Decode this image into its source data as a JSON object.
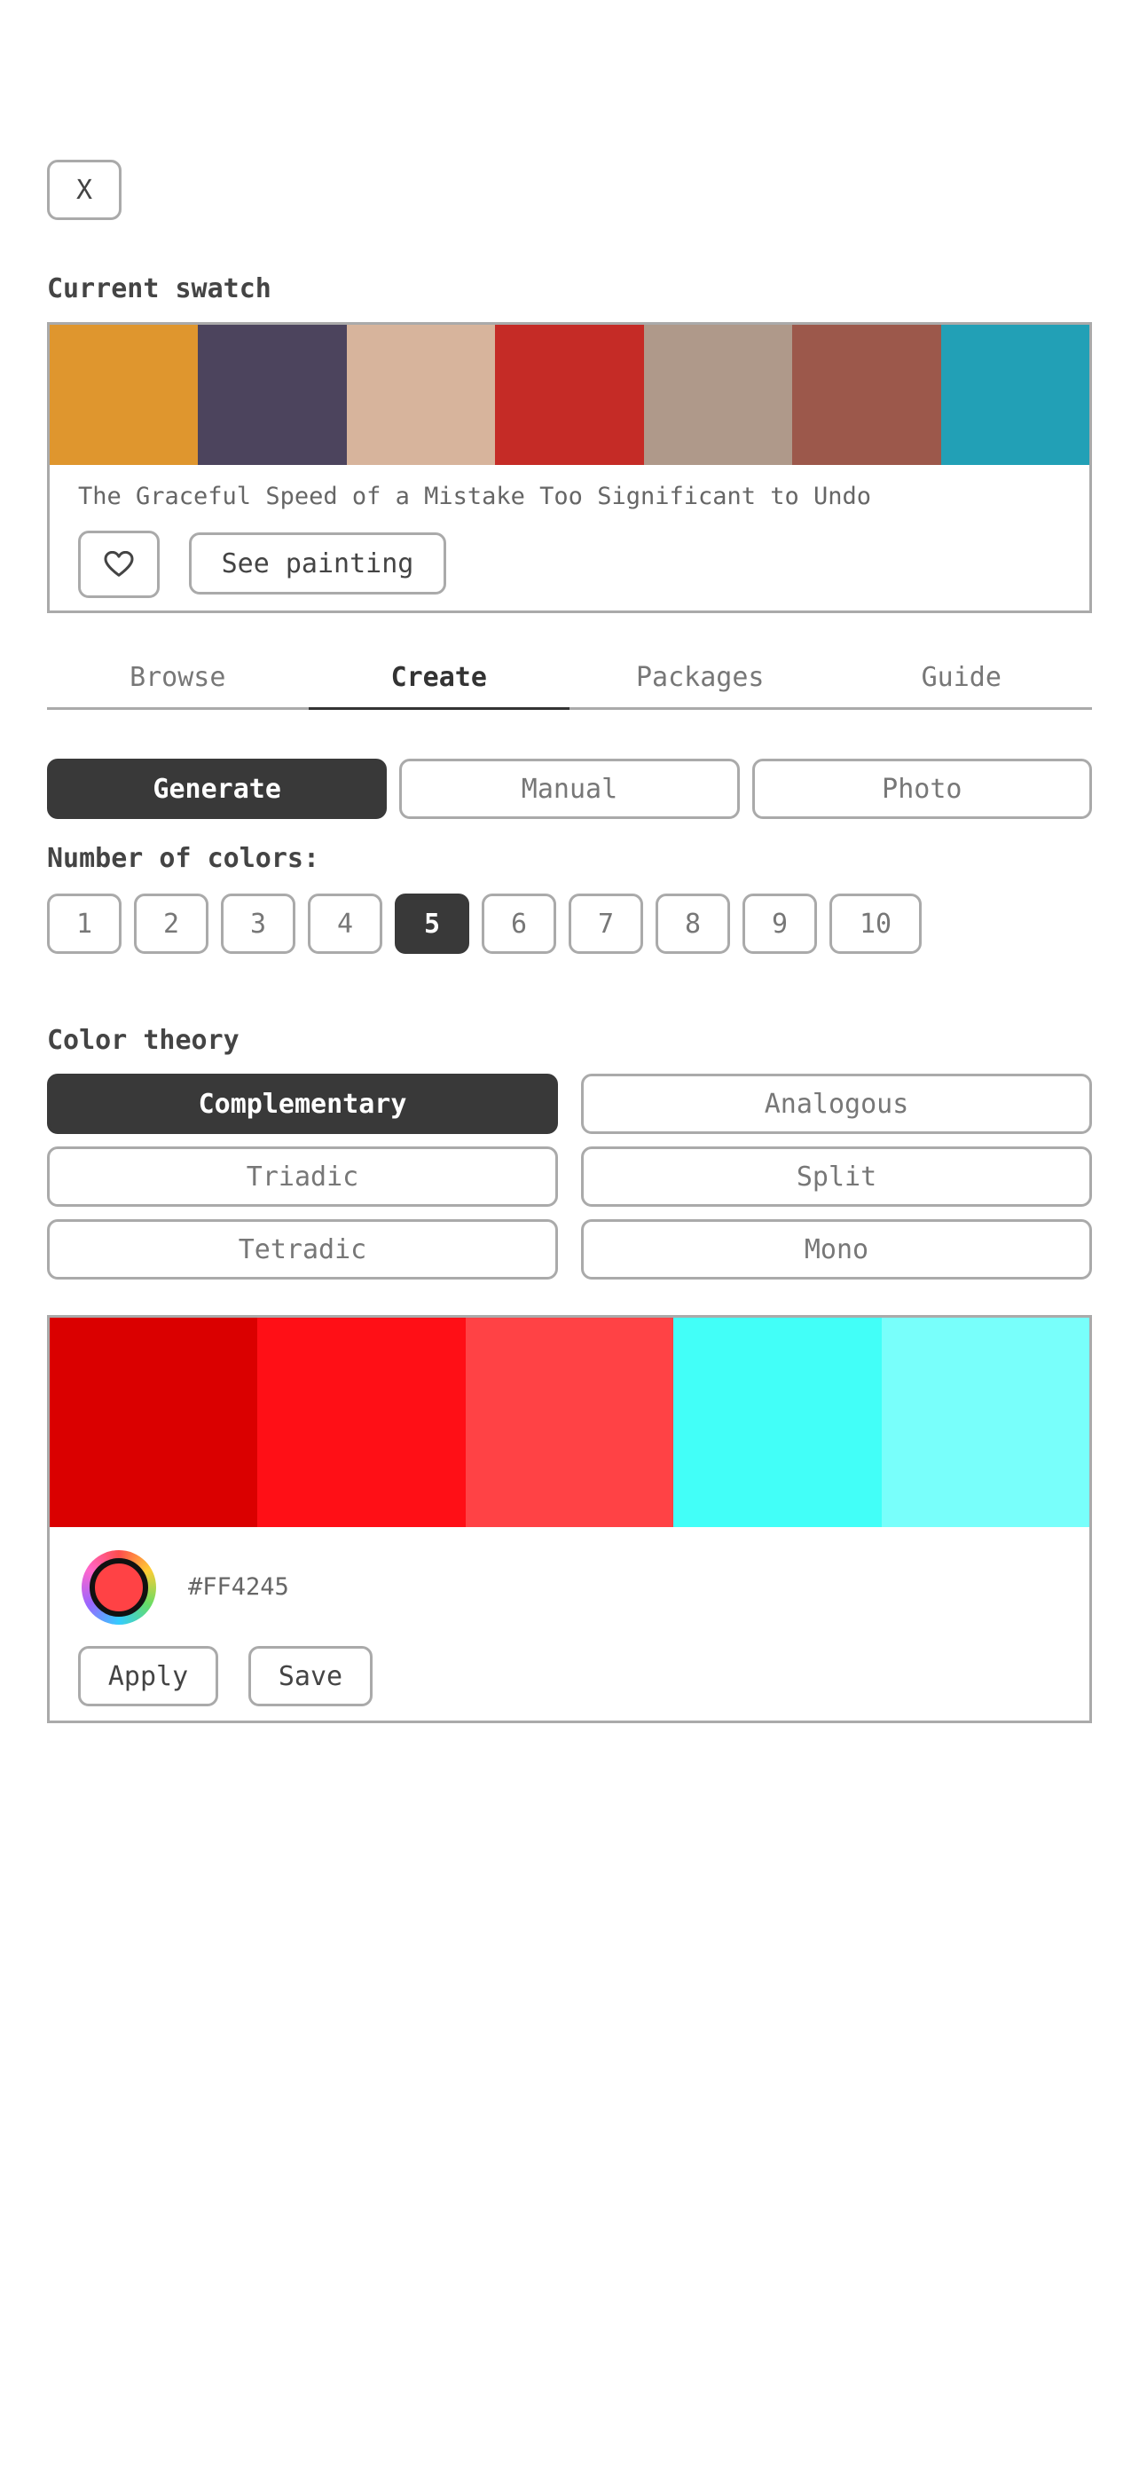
{
  "close_label": "X",
  "current": {
    "heading": "Current swatch",
    "colors": [
      "#DF962E",
      "#4C445D",
      "#D7B49C",
      "#C52B26",
      "#AF998A",
      "#9C584B",
      "#22A0B6"
    ],
    "painting_title": "The Graceful Speed of a Mistake Too Significant to Undo",
    "see_painting_label": "See painting",
    "favorite_icon": "heart-icon"
  },
  "tabs": [
    {
      "label": "Browse",
      "active": false
    },
    {
      "label": "Create",
      "active": true
    },
    {
      "label": "Packages",
      "active": false
    },
    {
      "label": "Guide",
      "active": false
    }
  ],
  "modes": [
    {
      "label": "Generate",
      "active": true
    },
    {
      "label": "Manual",
      "active": false
    },
    {
      "label": "Photo",
      "active": false
    }
  ],
  "color_count": {
    "heading": "Number of colors:",
    "options": [
      "1",
      "2",
      "3",
      "4",
      "5",
      "6",
      "7",
      "8",
      "9",
      "10"
    ],
    "selected": "5"
  },
  "theory": {
    "heading": "Color theory",
    "options": [
      {
        "label": "Complementary",
        "active": true
      },
      {
        "label": "Analogous",
        "active": false
      },
      {
        "label": "Triadic",
        "active": false
      },
      {
        "label": "Split",
        "active": false
      },
      {
        "label": "Tetradic",
        "active": false
      },
      {
        "label": "Mono",
        "active": false
      }
    ]
  },
  "generated": {
    "colors": [
      "#DA0000",
      "#FF0F16",
      "#FF4245",
      "#42FFF8",
      "#78FFFB"
    ],
    "selected_hex": "#FF4245",
    "apply_label": "Apply",
    "save_label": "Save"
  }
}
